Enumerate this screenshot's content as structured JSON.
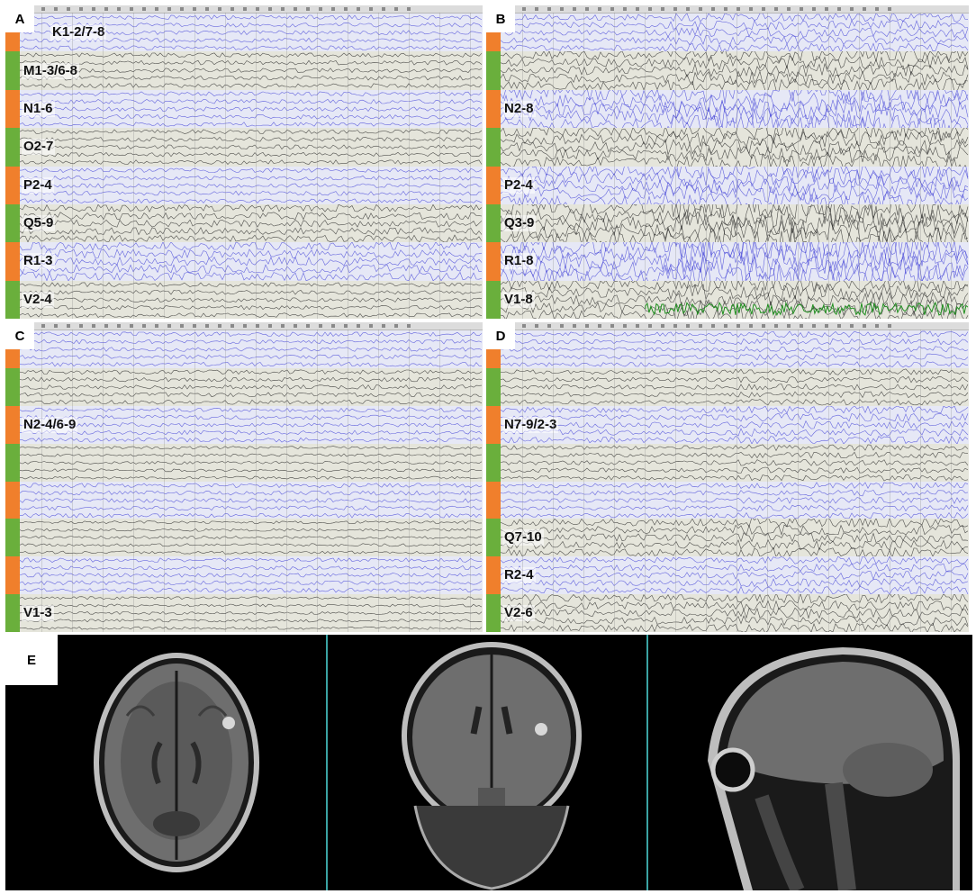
{
  "colors": {
    "orange": "#f07f2c",
    "green": "#6aaf3c",
    "blue_trace": "#3b3bd6",
    "black_trace": "#1c1c1c",
    "blue_bg": "#e6e8f6",
    "gray_bg": "#e5e5db",
    "mri_divider": "#3aa3a3"
  },
  "panels": {
    "A": {
      "letter": "A",
      "bands": [
        {
          "label": "K1-2/7-8",
          "color": "orange",
          "trace": "blue",
          "amp": 3
        },
        {
          "label": "M1-3/6-8",
          "color": "green",
          "trace": "black",
          "amp": 3
        },
        {
          "label": "N1-6",
          "color": "orange",
          "trace": "blue",
          "amp": 3
        },
        {
          "label": "O2-7",
          "color": "green",
          "trace": "black",
          "amp": 3
        },
        {
          "label": "P2-4",
          "color": "orange",
          "trace": "blue",
          "amp": 3
        },
        {
          "label": "Q5-9",
          "color": "green",
          "trace": "black",
          "amp": 5
        },
        {
          "label": "R1-3",
          "color": "orange",
          "trace": "blue",
          "amp": 6
        },
        {
          "label": "V2-4",
          "color": "green",
          "trace": "black",
          "amp": 3
        }
      ]
    },
    "B": {
      "letter": "B",
      "bands": [
        {
          "label": "",
          "color": "orange",
          "trace": "blue",
          "amp": 4
        },
        {
          "label": "",
          "color": "green",
          "trace": "black",
          "amp": 6
        },
        {
          "label": "N2-8",
          "color": "orange",
          "trace": "blue",
          "amp": 9
        },
        {
          "label": "",
          "color": "green",
          "trace": "black",
          "amp": 7
        },
        {
          "label": "P2-4",
          "color": "orange",
          "trace": "blue",
          "amp": 8
        },
        {
          "label": "Q3-9",
          "color": "green",
          "trace": "black",
          "amp": 10
        },
        {
          "label": "R1-8",
          "color": "orange",
          "trace": "blue",
          "amp": 11
        },
        {
          "label": "V1-8",
          "color": "green",
          "trace": "black",
          "amp": 7
        }
      ]
    },
    "C": {
      "letter": "C",
      "bands": [
        {
          "label": "",
          "color": "orange",
          "trace": "blue",
          "amp": 3
        },
        {
          "label": "",
          "color": "green",
          "trace": "black",
          "amp": 3
        },
        {
          "label": "N2-4/6-9",
          "color": "orange",
          "trace": "blue",
          "amp": 3
        },
        {
          "label": "",
          "color": "green",
          "trace": "black",
          "amp": 2
        },
        {
          "label": "",
          "color": "orange",
          "trace": "blue",
          "amp": 3
        },
        {
          "label": "",
          "color": "green",
          "trace": "black",
          "amp": 2
        },
        {
          "label": "",
          "color": "orange",
          "trace": "blue",
          "amp": 3
        },
        {
          "label": "V1-3",
          "color": "green",
          "trace": "black",
          "amp": 2
        }
      ]
    },
    "D": {
      "letter": "D",
      "bands": [
        {
          "label": "",
          "color": "orange",
          "trace": "blue",
          "amp": 3
        },
        {
          "label": "",
          "color": "green",
          "trace": "black",
          "amp": 3
        },
        {
          "label": "N7-9/2-3",
          "color": "orange",
          "trace": "blue",
          "amp": 4
        },
        {
          "label": "",
          "color": "green",
          "trace": "black",
          "amp": 3
        },
        {
          "label": "",
          "color": "orange",
          "trace": "blue",
          "amp": 3
        },
        {
          "label": "Q7-10",
          "color": "green",
          "trace": "black",
          "amp": 5
        },
        {
          "label": "R2-4",
          "color": "orange",
          "trace": "blue",
          "amp": 4
        },
        {
          "label": "V2-6",
          "color": "green",
          "trace": "black",
          "amp": 5
        }
      ]
    }
  },
  "mri": {
    "letter": "E",
    "views": [
      "axial",
      "coronal",
      "sagittal"
    ]
  }
}
